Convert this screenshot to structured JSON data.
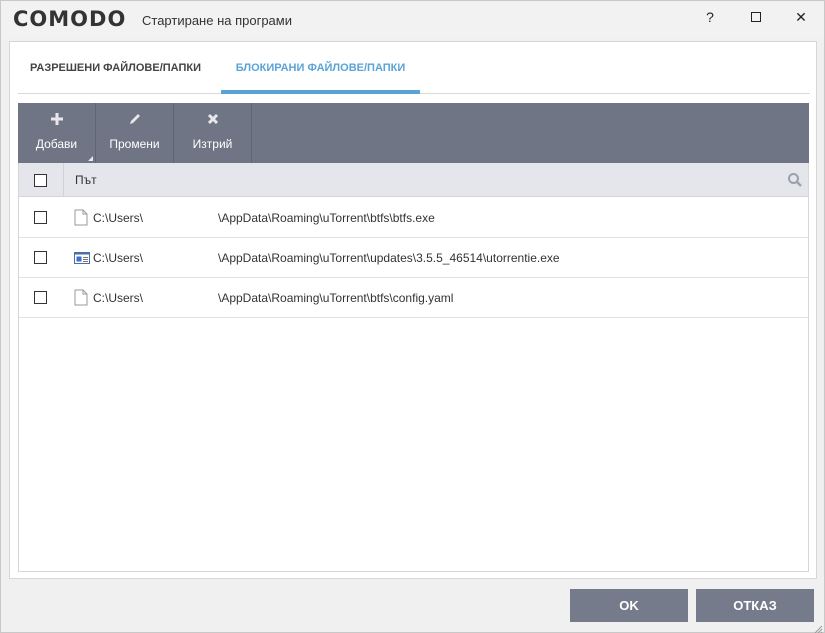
{
  "titlebar": {
    "logo": "COMODO",
    "title": "Стартиране на програми",
    "help_label": "?",
    "close_label": "✕"
  },
  "tabs": [
    {
      "label": "РАЗРЕШЕНИ ФАЙЛОВЕ/ПАПКИ",
      "active": false
    },
    {
      "label": "БЛОКИРАНИ ФАЙЛОВЕ/ПАПКИ",
      "active": true
    }
  ],
  "toolbar": {
    "add": {
      "label": "Добави",
      "icon": "plus-icon"
    },
    "edit": {
      "label": "Промени",
      "icon": "pencil-icon"
    },
    "delete": {
      "label": "Изтрий",
      "icon": "x-icon"
    }
  },
  "table": {
    "column_path": "Път",
    "rows": [
      {
        "path_prefix": "C:\\Users\\",
        "path_suffix": "\\AppData\\Roaming\\uTorrent\\btfs\\btfs.exe",
        "icon": "file-icon"
      },
      {
        "path_prefix": "C:\\Users\\",
        "path_suffix": "\\AppData\\Roaming\\uTorrent\\updates\\3.5.5_46514\\utorrentie.exe",
        "icon": "application-icon"
      },
      {
        "path_prefix": "C:\\Users\\",
        "path_suffix": "\\AppData\\Roaming\\uTorrent\\btfs\\config.yaml",
        "icon": "file-icon"
      }
    ]
  },
  "footer": {
    "ok_label": "OK",
    "cancel_label": "ОТКАЗ"
  },
  "colors": {
    "accent": "#5aa3d6",
    "toolbar": "#6f7585",
    "button": "#757b8b"
  }
}
